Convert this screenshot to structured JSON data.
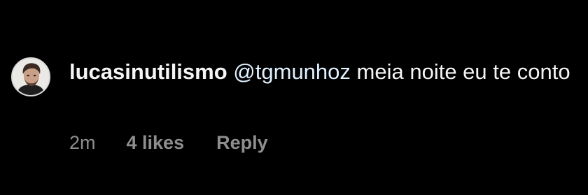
{
  "top_partial_text": "' ' ' ' ' ' ' ' ' '",
  "comment": {
    "username": "lucasinutilismo",
    "mention": "@tgmunhoz",
    "text": "meia noite eu te conto",
    "time": "2m",
    "likes": "4 likes",
    "reply_label": "Reply",
    "avatar_icon": "profile-photo"
  },
  "colors": {
    "background": "#000000",
    "text": "#f5f5f5",
    "mention": "#e0f1ff",
    "meta": "#8e8e8e"
  }
}
